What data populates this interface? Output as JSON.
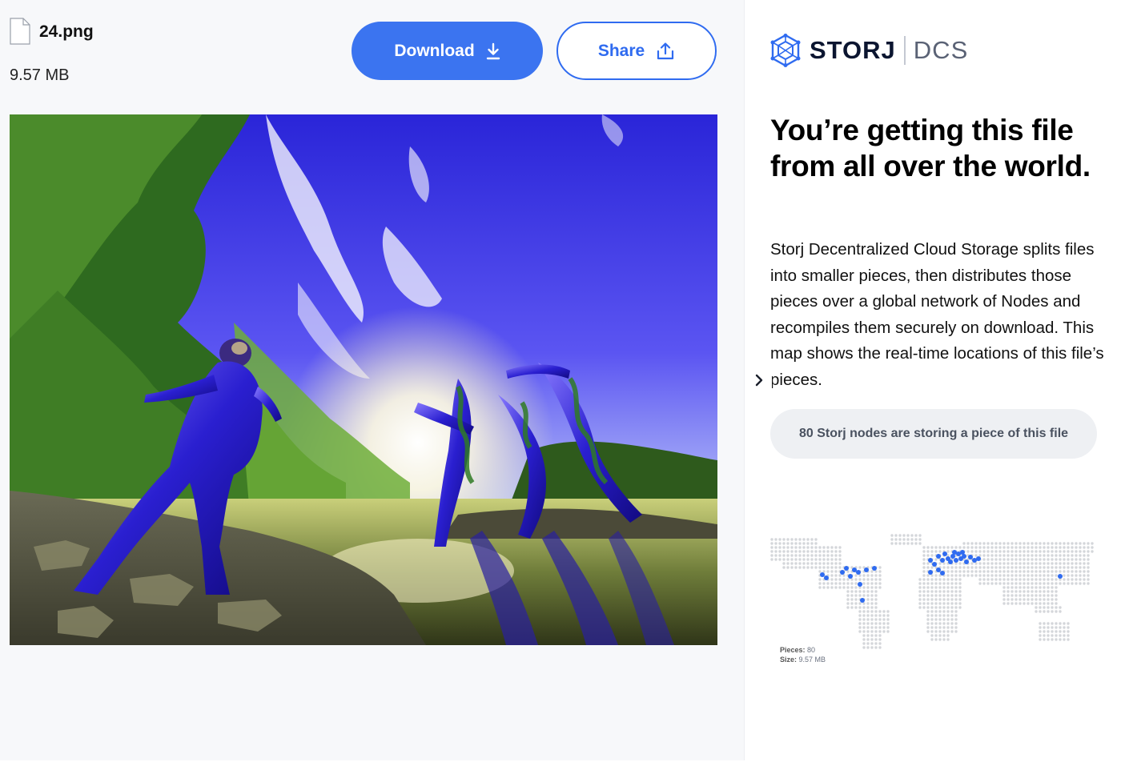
{
  "file": {
    "name": "24.png",
    "size": "9.57 MB"
  },
  "actions": {
    "download_label": "Download",
    "share_label": "Share"
  },
  "preview": {
    "icon": "image-preview"
  },
  "brand": {
    "name": "STORJ",
    "product": "DCS",
    "icon": "storj-hexagon-logo"
  },
  "sidebar": {
    "headline": "You’re getting this file from all over the world.",
    "description": "Storj Decentralized Cloud Storage splits files into smaller pieces, then distributes those pieces over a global network of Nodes and recompiles them securely on download. This map shows the real-time locations of this file’s pieces.",
    "nodes_summary": "80 Storj nodes are storing a piece of this file"
  },
  "map_legend": {
    "pieces_label": "Pieces:",
    "pieces_value": "80",
    "size_label": "Size:",
    "size_value": "9.57 MB"
  },
  "colors": {
    "accent": "#3b74f0",
    "node_dot": "#2f6bf0",
    "map_dot": "#d4d6da"
  }
}
